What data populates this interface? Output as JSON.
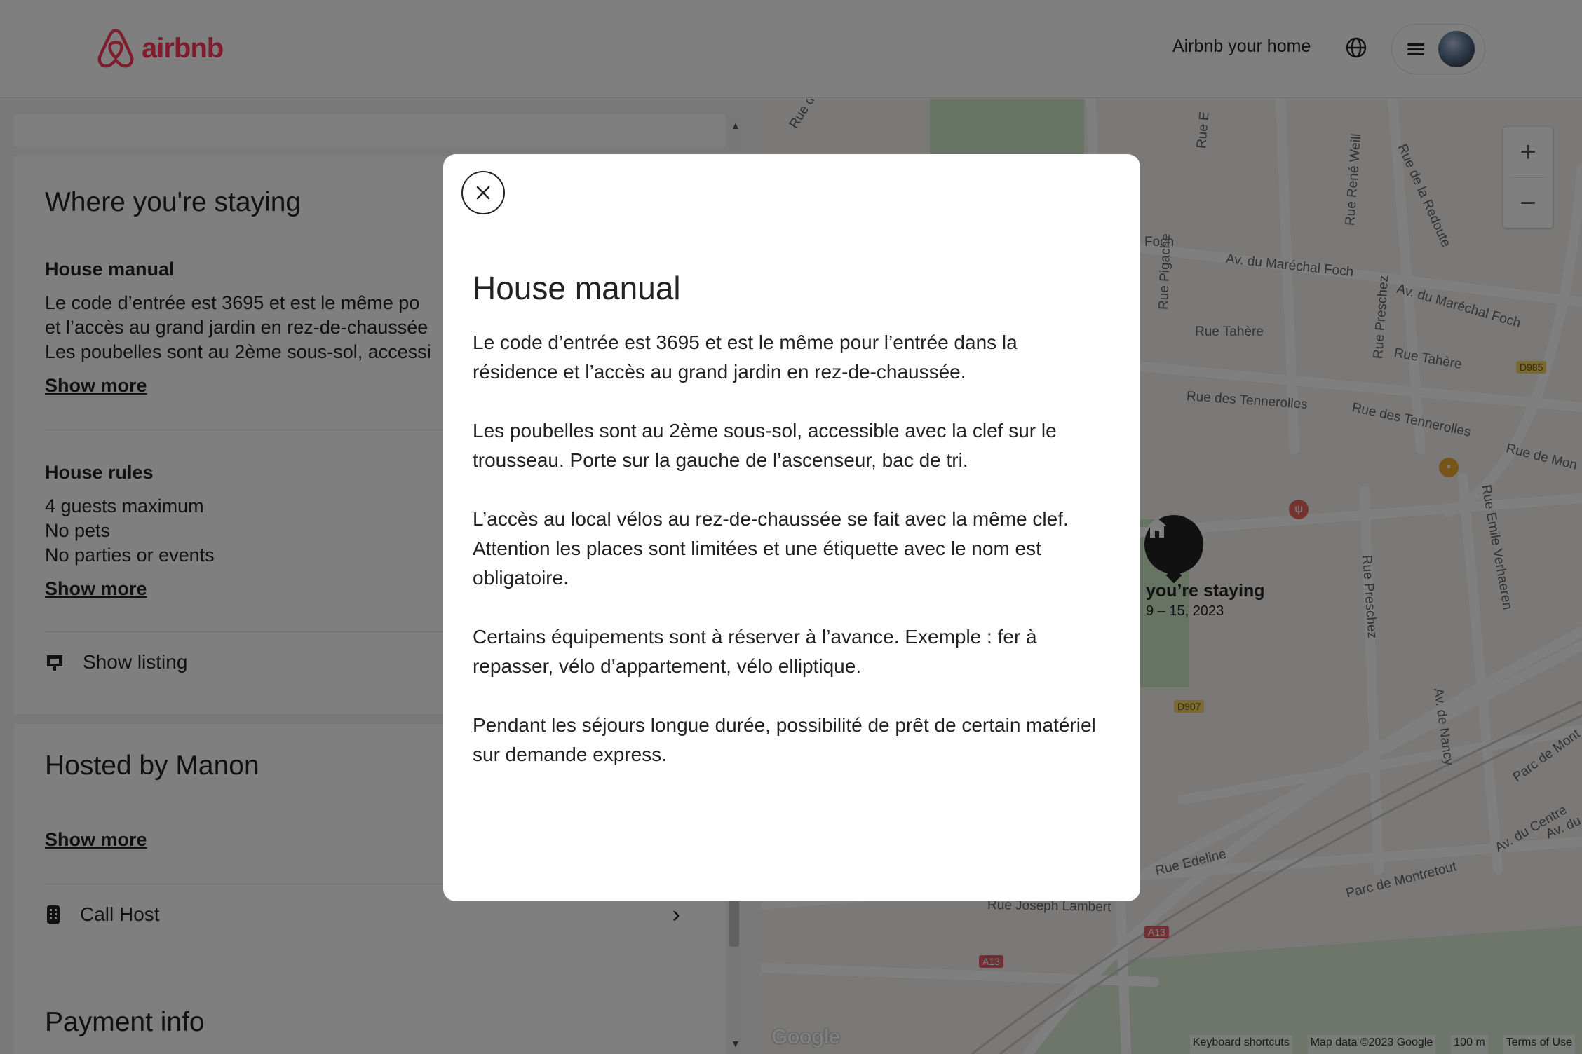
{
  "header": {
    "logo_text": "airbnb",
    "host_link": "Airbnb your home"
  },
  "left": {
    "staying": {
      "title": "Where you're staying",
      "manual_title": "House manual",
      "manual_lines": [
        "Le code d’entrée est 3695 et est le même po",
        "et l’accès au grand jardin en rez-de-chaussée",
        "Les poubelles sont au 2ème sous-sol, accessi"
      ],
      "show_more": "Show more",
      "rules_title": "House rules",
      "rules": [
        "4 guests maximum",
        "No pets",
        "No parties or events"
      ],
      "rules_show_more": "Show more",
      "show_listing": "Show listing"
    },
    "host": {
      "title": "Hosted by Manon",
      "show_more": "Show more",
      "call_host": "Call Host"
    },
    "payment": {
      "title": "Payment info"
    }
  },
  "map": {
    "labels": [
      "Rue d",
      "Rue E",
      "Rue René Weill",
      "Rue de la Redoute",
      "Foch",
      "Av. du Maréchal Foch",
      "Av. du Maréchal Foch",
      "Rue Pigache",
      "Rue Tahère",
      "Rue Preschez",
      "Rue Tahère",
      "Rue des Tennerolles",
      "Rue des Tennerolles",
      "Rue de Mon",
      "Rue Emile Verhaeren",
      "Rue Preschez",
      "Av. de Nancy",
      "Rue Edeline",
      "Parc de Montretout",
      "Av. du Centre",
      "Parc de Mont",
      "Rue Joseph Lambert",
      "Av. du"
    ],
    "road_badges": [
      "D985",
      "D907",
      "A13",
      "A13"
    ],
    "pin_label": "you’re staying",
    "pin_dates": "9 – 15, 2023",
    "zoom_in": "+",
    "zoom_out": "−",
    "google": "Google",
    "footer": [
      "Keyboard shortcuts",
      "Map data ©2023 Google",
      "100 m",
      "Terms of Use"
    ]
  },
  "modal": {
    "title": "House manual",
    "paragraphs": [
      "Le code d’entrée est 3695 et est le même pour l’entrée dans la résidence et l’accès au grand jardin en rez-de-chaussée.",
      "Les poubelles sont au 2ème sous-sol, accessible avec la clef sur le trousseau. Porte sur la gauche de l’ascenseur, bac de tri.",
      "L’accès au local vélos au rez-de-chaussée se fait avec la même clef. Attention les places sont limitées et une étiquette avec le nom est obligatoire.",
      "Certains équipements sont à réserver à l’avance. Exemple : fer à repasser, vélo d’appartement, vélo elliptique.",
      "Pendant les séjours longue durée, possibilité de prêt de certain matériel sur demande express."
    ]
  },
  "colors": {
    "brand": "#ff385c",
    "overlay": "rgba(0,0,0,0.5)",
    "park": "#cfe8c6"
  },
  "icons": [
    "airbnb-logo-icon",
    "globe-icon",
    "menu-icon",
    "close-icon",
    "listing-icon",
    "phone-icon",
    "chevron-right-icon",
    "home-icon"
  ]
}
